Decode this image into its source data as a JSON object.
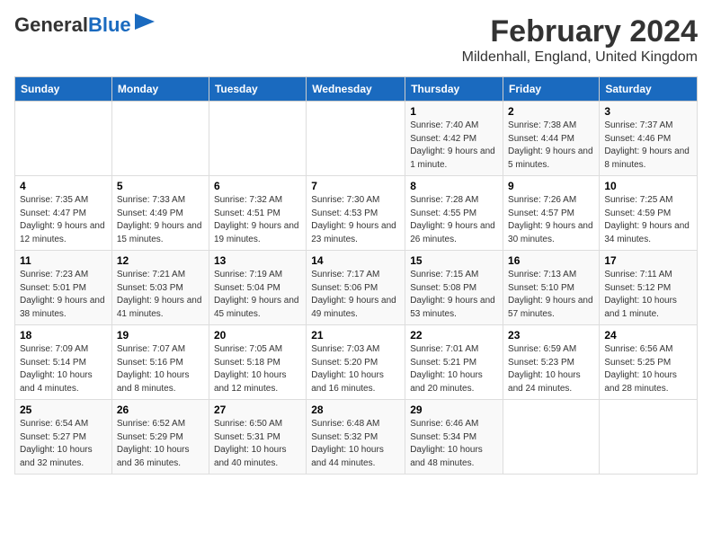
{
  "header": {
    "logo_line1": "General",
    "logo_line2": "Blue",
    "month": "February 2024",
    "location": "Mildenhall, England, United Kingdom"
  },
  "weekdays": [
    "Sunday",
    "Monday",
    "Tuesday",
    "Wednesday",
    "Thursday",
    "Friday",
    "Saturday"
  ],
  "weeks": [
    [
      {
        "day": "",
        "info": ""
      },
      {
        "day": "",
        "info": ""
      },
      {
        "day": "",
        "info": ""
      },
      {
        "day": "",
        "info": ""
      },
      {
        "day": "1",
        "info": "Sunrise: 7:40 AM\nSunset: 4:42 PM\nDaylight: 9 hours and 1 minute."
      },
      {
        "day": "2",
        "info": "Sunrise: 7:38 AM\nSunset: 4:44 PM\nDaylight: 9 hours and 5 minutes."
      },
      {
        "day": "3",
        "info": "Sunrise: 7:37 AM\nSunset: 4:46 PM\nDaylight: 9 hours and 8 minutes."
      }
    ],
    [
      {
        "day": "4",
        "info": "Sunrise: 7:35 AM\nSunset: 4:47 PM\nDaylight: 9 hours and 12 minutes."
      },
      {
        "day": "5",
        "info": "Sunrise: 7:33 AM\nSunset: 4:49 PM\nDaylight: 9 hours and 15 minutes."
      },
      {
        "day": "6",
        "info": "Sunrise: 7:32 AM\nSunset: 4:51 PM\nDaylight: 9 hours and 19 minutes."
      },
      {
        "day": "7",
        "info": "Sunrise: 7:30 AM\nSunset: 4:53 PM\nDaylight: 9 hours and 23 minutes."
      },
      {
        "day": "8",
        "info": "Sunrise: 7:28 AM\nSunset: 4:55 PM\nDaylight: 9 hours and 26 minutes."
      },
      {
        "day": "9",
        "info": "Sunrise: 7:26 AM\nSunset: 4:57 PM\nDaylight: 9 hours and 30 minutes."
      },
      {
        "day": "10",
        "info": "Sunrise: 7:25 AM\nSunset: 4:59 PM\nDaylight: 9 hours and 34 minutes."
      }
    ],
    [
      {
        "day": "11",
        "info": "Sunrise: 7:23 AM\nSunset: 5:01 PM\nDaylight: 9 hours and 38 minutes."
      },
      {
        "day": "12",
        "info": "Sunrise: 7:21 AM\nSunset: 5:03 PM\nDaylight: 9 hours and 41 minutes."
      },
      {
        "day": "13",
        "info": "Sunrise: 7:19 AM\nSunset: 5:04 PM\nDaylight: 9 hours and 45 minutes."
      },
      {
        "day": "14",
        "info": "Sunrise: 7:17 AM\nSunset: 5:06 PM\nDaylight: 9 hours and 49 minutes."
      },
      {
        "day": "15",
        "info": "Sunrise: 7:15 AM\nSunset: 5:08 PM\nDaylight: 9 hours and 53 minutes."
      },
      {
        "day": "16",
        "info": "Sunrise: 7:13 AM\nSunset: 5:10 PM\nDaylight: 9 hours and 57 minutes."
      },
      {
        "day": "17",
        "info": "Sunrise: 7:11 AM\nSunset: 5:12 PM\nDaylight: 10 hours and 1 minute."
      }
    ],
    [
      {
        "day": "18",
        "info": "Sunrise: 7:09 AM\nSunset: 5:14 PM\nDaylight: 10 hours and 4 minutes."
      },
      {
        "day": "19",
        "info": "Sunrise: 7:07 AM\nSunset: 5:16 PM\nDaylight: 10 hours and 8 minutes."
      },
      {
        "day": "20",
        "info": "Sunrise: 7:05 AM\nSunset: 5:18 PM\nDaylight: 10 hours and 12 minutes."
      },
      {
        "day": "21",
        "info": "Sunrise: 7:03 AM\nSunset: 5:20 PM\nDaylight: 10 hours and 16 minutes."
      },
      {
        "day": "22",
        "info": "Sunrise: 7:01 AM\nSunset: 5:21 PM\nDaylight: 10 hours and 20 minutes."
      },
      {
        "day": "23",
        "info": "Sunrise: 6:59 AM\nSunset: 5:23 PM\nDaylight: 10 hours and 24 minutes."
      },
      {
        "day": "24",
        "info": "Sunrise: 6:56 AM\nSunset: 5:25 PM\nDaylight: 10 hours and 28 minutes."
      }
    ],
    [
      {
        "day": "25",
        "info": "Sunrise: 6:54 AM\nSunset: 5:27 PM\nDaylight: 10 hours and 32 minutes."
      },
      {
        "day": "26",
        "info": "Sunrise: 6:52 AM\nSunset: 5:29 PM\nDaylight: 10 hours and 36 minutes."
      },
      {
        "day": "27",
        "info": "Sunrise: 6:50 AM\nSunset: 5:31 PM\nDaylight: 10 hours and 40 minutes."
      },
      {
        "day": "28",
        "info": "Sunrise: 6:48 AM\nSunset: 5:32 PM\nDaylight: 10 hours and 44 minutes."
      },
      {
        "day": "29",
        "info": "Sunrise: 6:46 AM\nSunset: 5:34 PM\nDaylight: 10 hours and 48 minutes."
      },
      {
        "day": "",
        "info": ""
      },
      {
        "day": "",
        "info": ""
      }
    ]
  ]
}
